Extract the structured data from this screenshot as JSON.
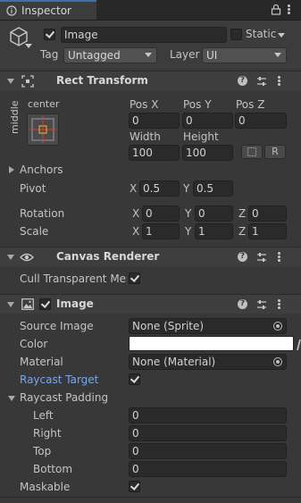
{
  "tab": {
    "title": "Inspector"
  },
  "gameobject": {
    "name": "Image",
    "active": true,
    "static_label": "Static",
    "static": false,
    "tag_label": "Tag",
    "tag_value": "Untagged",
    "layer_label": "Layer",
    "layer_value": "UI"
  },
  "rect_transform": {
    "title": "Rect Transform",
    "anchor_h": "center",
    "anchor_v": "middle",
    "headers": {
      "pos_x": "Pos X",
      "pos_y": "Pos Y",
      "pos_z": "Pos Z",
      "width": "Width",
      "height": "Height"
    },
    "values": {
      "pos_x": "0",
      "pos_y": "0",
      "pos_z": "0",
      "width": "100",
      "height": "100"
    },
    "raw_button": "R",
    "anchors_label": "Anchors",
    "pivot_label": "Pivot",
    "pivot": {
      "x": "0.5",
      "y": "0.5"
    },
    "rotation_label": "Rotation",
    "rotation": {
      "x": "0",
      "y": "0",
      "z": "0"
    },
    "scale_label": "Scale",
    "scale": {
      "x": "1",
      "y": "1",
      "z": "1"
    },
    "axis": {
      "x": "X",
      "y": "Y",
      "z": "Z"
    }
  },
  "canvas_renderer": {
    "title": "Canvas Renderer",
    "cull_label": "Cull Transparent Mes",
    "cull": true
  },
  "image_component": {
    "title": "Image",
    "enabled": true,
    "source_image_label": "Source Image",
    "source_image_value": "None (Sprite)",
    "color_label": "Color",
    "color_value": "#ffffff",
    "material_label": "Material",
    "material_value": "None (Material)",
    "raycast_target_label": "Raycast Target",
    "raycast_target": true,
    "raycast_padding_label": "Raycast Padding",
    "padding": [
      {
        "label": "Left",
        "value": "0"
      },
      {
        "label": "Right",
        "value": "0"
      },
      {
        "label": "Top",
        "value": "0"
      },
      {
        "label": "Bottom",
        "value": "0"
      }
    ],
    "maskable_label": "Maskable",
    "maskable": true
  },
  "colors": {
    "accent": "#3a72b0",
    "link_label": "#7aa7e8",
    "anchor_cross": "#d83a3a",
    "anchor_dot": "#e0a030"
  }
}
